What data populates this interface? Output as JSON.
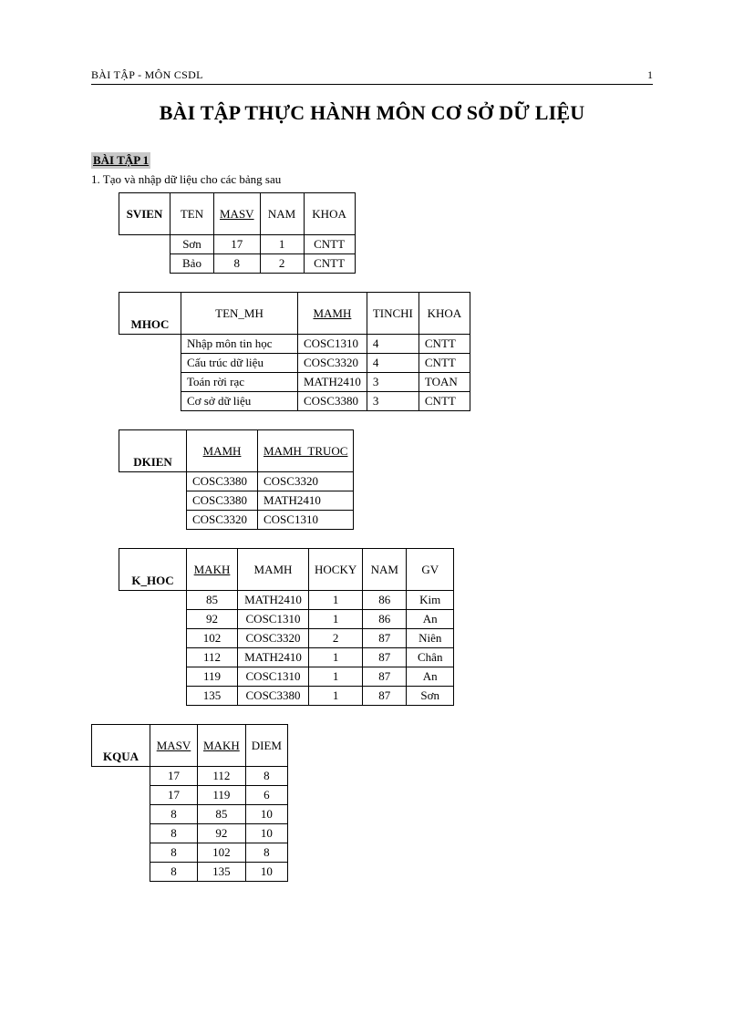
{
  "header": {
    "left": "BÀI TẬP  - MÔN CSDL",
    "right": "1"
  },
  "title": "BÀI TẬP THỰC HÀNH MÔN CƠ SỞ DỮ LIỆU",
  "exercise_label": "BÀI TẬP 1",
  "instruction": "1.  Tạo và nhập dữ liệu cho các bảng sau",
  "tables": {
    "svien": {
      "name": "SVIEN",
      "headers": [
        "TEN",
        "MASV",
        "NAM",
        "KHOA"
      ],
      "underline": [
        false,
        true,
        false,
        false
      ],
      "rows": [
        [
          "Sơn",
          "17",
          "1",
          "CNTT"
        ],
        [
          "Bảo",
          "8",
          "2",
          "CNTT"
        ]
      ]
    },
    "mhoc": {
      "name": "MHOC",
      "headers": [
        "TEN_MH",
        "MAMH",
        "TINCHI",
        "KHOA"
      ],
      "underline": [
        false,
        true,
        false,
        false
      ],
      "rows": [
        [
          "Nhập môn tin học",
          "COSC1310",
          "4",
          "CNTT"
        ],
        [
          "Cấu trúc dữ liệu",
          "COSC3320",
          "4",
          "CNTT"
        ],
        [
          "Toán rời rạc",
          "MATH2410",
          "3",
          "TOAN"
        ],
        [
          "Cơ sở dữ liệu",
          "COSC3380",
          "3",
          "CNTT"
        ]
      ]
    },
    "dkien": {
      "name": "DKIEN",
      "headers": [
        "MAMH",
        "MAMH_TRUOC"
      ],
      "underline": [
        true,
        true
      ],
      "rows": [
        [
          "COSC3380",
          "COSC3320"
        ],
        [
          "COSC3380",
          "MATH2410"
        ],
        [
          "COSC3320",
          "COSC1310"
        ]
      ]
    },
    "khoc": {
      "name": "K_HOC",
      "headers": [
        "MAKH",
        "MAMH",
        "HOCKY",
        "NAM",
        "GV"
      ],
      "underline": [
        true,
        false,
        false,
        false,
        false
      ],
      "rows": [
        [
          "85",
          "MATH2410",
          "1",
          "86",
          "Kim"
        ],
        [
          "92",
          "COSC1310",
          "1",
          "86",
          "An"
        ],
        [
          "102",
          "COSC3320",
          "2",
          "87",
          "Niên"
        ],
        [
          "112",
          "MATH2410",
          "1",
          "87",
          "Chân"
        ],
        [
          "119",
          "COSC1310",
          "1",
          "87",
          "An"
        ],
        [
          "135",
          "COSC3380",
          "1",
          "87",
          "Sơn"
        ]
      ]
    },
    "kqua": {
      "name": "KQUA",
      "headers": [
        "MASV",
        "MAKH",
        "DIEM"
      ],
      "underline": [
        true,
        true,
        false
      ],
      "rows": [
        [
          "17",
          "112",
          "8"
        ],
        [
          "17",
          "119",
          "6"
        ],
        [
          "8",
          "85",
          "10"
        ],
        [
          "8",
          "92",
          "10"
        ],
        [
          "8",
          "102",
          "8"
        ],
        [
          "8",
          "135",
          "10"
        ]
      ]
    }
  }
}
